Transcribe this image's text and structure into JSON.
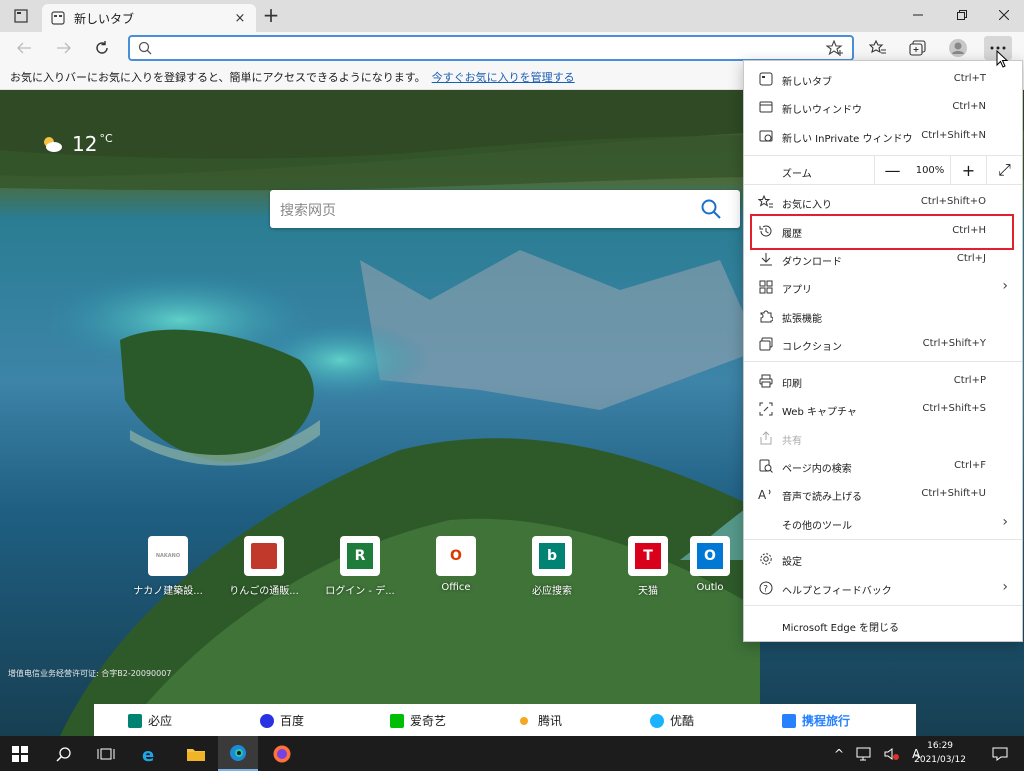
{
  "tab": {
    "title": "新しいタブ",
    "close": "×",
    "new": "+"
  },
  "window": {
    "minimize": "—",
    "maximize": "❐",
    "close": "✕"
  },
  "address": {
    "value": "",
    "placeholder": ""
  },
  "favorites_bar": {
    "text": "お気に入りバーにお気に入りを登録すると、簡単にアクセスできるようになります。",
    "link": "今すぐお気に入りを管理する"
  },
  "weather": {
    "temp": "12",
    "unit": "°C"
  },
  "search": {
    "placeholder": "搜索网页"
  },
  "tiles": [
    {
      "label": "ナカノ建築設...",
      "icon_text": "",
      "color": "#ffffff",
      "fg": "#999"
    },
    {
      "label": "りんごの通販...",
      "icon_text": "",
      "color": "#c0392b",
      "fg": "#fff"
    },
    {
      "label": "ログイン - デ...",
      "icon_text": "R",
      "color": "#1e7d3b",
      "fg": "#fff"
    },
    {
      "label": "Office",
      "icon_text": "O",
      "color": "#ffffff",
      "fg": "#d83b01"
    },
    {
      "label": "必应搜索",
      "icon_text": "b",
      "color": "#ffffff",
      "fg": "#008373"
    },
    {
      "label": "天猫",
      "icon_text": "T",
      "color": "#ffffff",
      "fg": "#d8001b"
    },
    {
      "label": "Outlo",
      "icon_text": "O",
      "color": "#ffffff",
      "fg": "#0078d4"
    }
  ],
  "license": "增值电信业务经营许可证: 合字B2-20090007",
  "quickbar": [
    {
      "label": "必应",
      "color": "#008373"
    },
    {
      "label": "百度",
      "color": "#2932e1"
    },
    {
      "label": "爱奇艺",
      "color": "#00be06"
    },
    {
      "label": "腾讯",
      "color": "#f5a623"
    },
    {
      "label": "优酷",
      "color": "#1ab3ff"
    },
    {
      "label": "携程旅行",
      "color": "#2681ff"
    }
  ],
  "menu": {
    "new_tab": {
      "label": "新しいタブ",
      "shortcut": "Ctrl+T"
    },
    "new_window": {
      "label": "新しいウィンドウ",
      "shortcut": "Ctrl+N"
    },
    "new_inprivate": {
      "label": "新しい InPrivate ウィンドウ",
      "shortcut": "Ctrl+Shift+N"
    },
    "zoom": {
      "label": "ズーム",
      "minus": "—",
      "value": "100%",
      "plus": "+",
      "fullscreen": "⤢"
    },
    "favorites": {
      "label": "お気に入り",
      "shortcut": "Ctrl+Shift+O"
    },
    "history": {
      "label": "履歴",
      "shortcut": "Ctrl+H"
    },
    "downloads": {
      "label": "ダウンロード",
      "shortcut": "Ctrl+J"
    },
    "apps": {
      "label": "アプリ",
      "arrow": "›"
    },
    "extensions": {
      "label": "拡張機能"
    },
    "collections": {
      "label": "コレクション",
      "shortcut": "Ctrl+Shift+Y"
    },
    "print": {
      "label": "印刷",
      "shortcut": "Ctrl+P"
    },
    "web_capture": {
      "label": "Web キャプチャ",
      "shortcut": "Ctrl+Shift+S"
    },
    "share": {
      "label": "共有"
    },
    "find": {
      "label": "ページ内の検索",
      "shortcut": "Ctrl+F"
    },
    "read_aloud": {
      "label": "音声で読み上げる",
      "shortcut": "Ctrl+Shift+U"
    },
    "more_tools": {
      "label": "その他のツール",
      "arrow": "›"
    },
    "settings": {
      "label": "設定"
    },
    "help": {
      "label": "ヘルプとフィードバック",
      "arrow": "›"
    },
    "close_edge": {
      "label": "Microsoft Edge を閉じる"
    }
  },
  "taskbar": {
    "time": "16:29",
    "date": "2021/03/12",
    "ime": "A"
  }
}
